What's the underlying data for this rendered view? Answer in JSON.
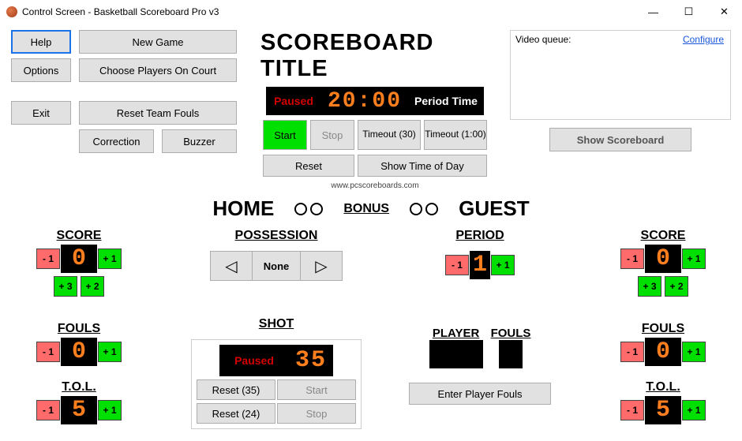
{
  "titlebar": {
    "title": "Control Screen - Basketball Scoreboard Pro v3"
  },
  "buttons": {
    "help": "Help",
    "options": "Options",
    "exit": "Exit",
    "new_game": "New Game",
    "choose_players": "Choose Players On Court",
    "reset_fouls": "Reset Team Fouls",
    "correction": "Correction",
    "buzzer": "Buzzer",
    "start": "Start",
    "stop": "Stop",
    "timeout30": "Timeout (30)",
    "timeout100": "Timeout (1:00)",
    "reset": "Reset",
    "show_time": "Show Time of Day",
    "show_scoreboard": "Show Scoreboard",
    "enter_pf": "Enter Player Fouls",
    "shot_reset35": "Reset (35)",
    "shot_reset24": "Reset (24)",
    "shot_start": "Start",
    "shot_stop": "Stop"
  },
  "scoreboard": {
    "title": "SCOREBOARD TITLE",
    "paused": "Paused",
    "clock": "20:00",
    "period_time": "Period Time",
    "url": "www.pcscoreboards.com"
  },
  "video": {
    "label": "Video queue:",
    "configure": "Configure"
  },
  "bonus": {
    "home": "HOME",
    "guest": "GUEST",
    "label": "BONUS"
  },
  "labels": {
    "score": "SCORE",
    "fouls": "FOULS",
    "tol": "T.O.L.",
    "possession": "POSSESSION",
    "none": "None",
    "shot": "SHOT",
    "period": "PERIOD",
    "player": "PLAYER",
    "foulsH": "FOULS"
  },
  "adj": {
    "minus1": "- 1",
    "plus1": "+ 1",
    "plus2": "+ 2",
    "plus3": "+ 3"
  },
  "home": {
    "score": "0",
    "fouls": "0",
    "tol": "5"
  },
  "guest": {
    "score": "0",
    "fouls": "0",
    "tol": "5"
  },
  "period": "1",
  "shot": {
    "paused": "Paused",
    "time": "35"
  },
  "playerfouls": {
    "player": "",
    "fouls": ""
  },
  "arrows": {
    "left": "◁",
    "right": "▷"
  },
  "winctl": {
    "min": "—",
    "max": "☐",
    "close": "✕"
  }
}
